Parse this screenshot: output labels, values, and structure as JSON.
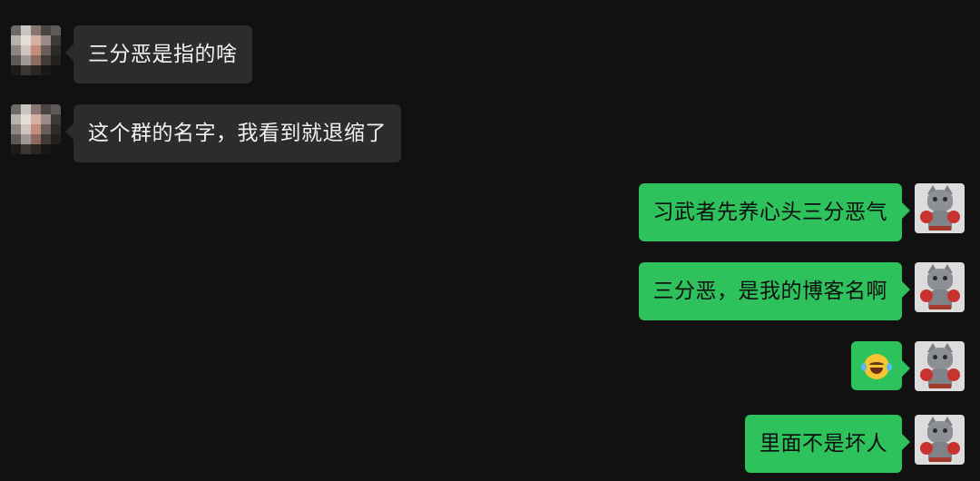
{
  "messages": [
    {
      "side": "left",
      "sender": "other",
      "text": "三分恶是指的啥"
    },
    {
      "side": "left",
      "sender": "other",
      "text": "这个群的名字，我看到就退缩了"
    },
    {
      "side": "right",
      "sender": "me",
      "text": "习武者先养心头三分恶气"
    },
    {
      "side": "right",
      "sender": "me",
      "text": "三分恶，是我的博客名啊"
    },
    {
      "side": "right",
      "sender": "me",
      "text": "",
      "emoji": "rolling-on-floor-laughing-emoji"
    },
    {
      "side": "right",
      "sender": "me",
      "text": "里面不是坏人"
    }
  ],
  "colors": {
    "background": "#111111",
    "incoming_bubble": "#2c2c2c",
    "outgoing_bubble": "#2ec25c"
  }
}
